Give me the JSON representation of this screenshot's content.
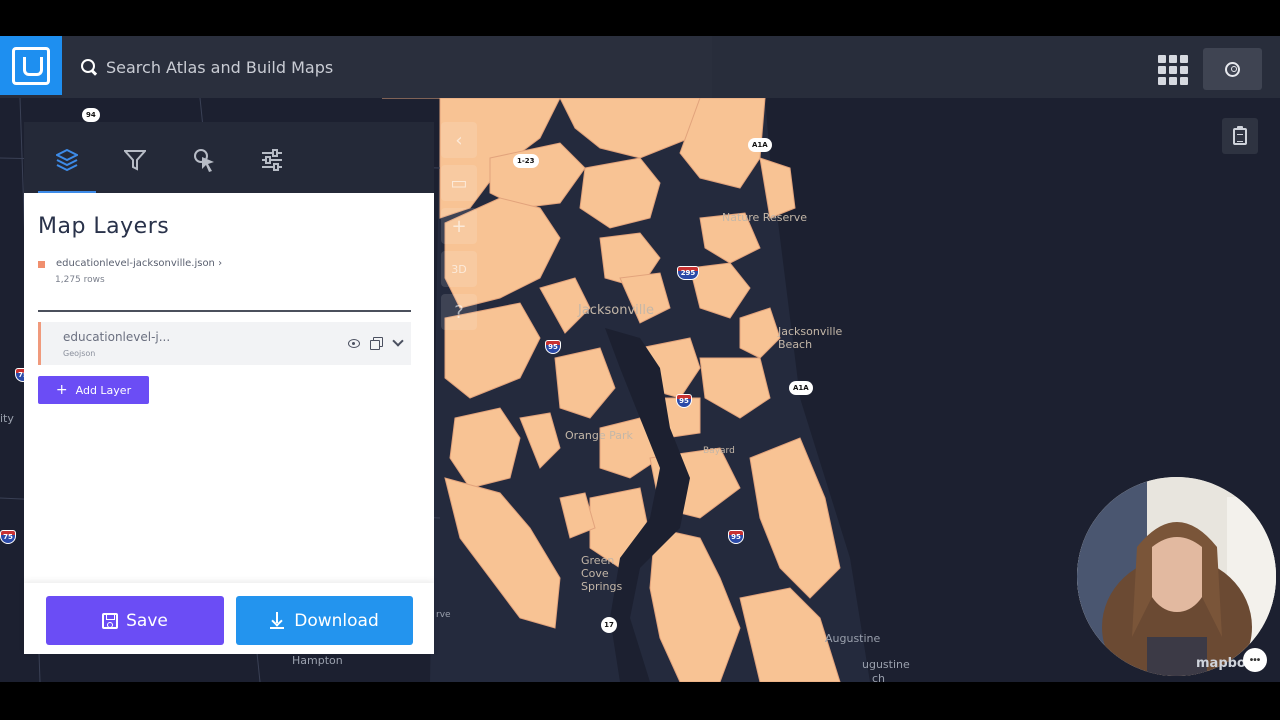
{
  "app": {
    "name": "Atlas"
  },
  "search": {
    "placeholder": "Search Atlas and Build Maps"
  },
  "panel": {
    "tabs": [
      {
        "icon": "layers-icon",
        "active": true
      },
      {
        "icon": "filter-icon",
        "active": false
      },
      {
        "icon": "cursor-icon",
        "active": false
      },
      {
        "icon": "sliders-icon",
        "active": false
      }
    ],
    "title": "Map Layers",
    "dataset": {
      "name": "educationlevel-jacksonville.json",
      "rows": "1,275 rows",
      "color": "#f08f6e"
    },
    "layer": {
      "name": "educationlevel-j...",
      "type": "Geojson",
      "color": "#f09a7c"
    },
    "add_layer_label": "Add Layer",
    "save_label": "Save",
    "download_label": "Download"
  },
  "map_controls": [
    {
      "icon": "collapse-left-icon",
      "glyph": "‹"
    },
    {
      "icon": "split-map-icon",
      "glyph": "▭"
    },
    {
      "icon": "zoom-in-icon",
      "glyph": "+"
    },
    {
      "icon": "3d-view-icon",
      "glyph": "3D"
    },
    {
      "icon": "help-icon",
      "glyph": "?"
    }
  ],
  "map": {
    "fill_color": "#f8c394",
    "base_color": "#1c2030",
    "labels": {
      "nature_reserve": "Nature Reserve",
      "jacksonville": "Jacksonville",
      "jacksonville_beach": "Jacksonville Beach",
      "orange_park": "Orange Park",
      "bayard": "Bayard",
      "green_cove_springs": "Green Cove Springs",
      "st_augustine": "Augustine",
      "hampton": "Hampton",
      "city": "ity",
      "rve": "rve",
      "ugustine": "ugustine",
      "ch": "ch"
    },
    "shields": {
      "r94": "94",
      "i295": "295",
      "i95a": "95",
      "i95b": "95",
      "i95c": "95",
      "i75a": "75",
      "i75b": "75",
      "a1a_a": "A1A",
      "a1a_b": "A1A",
      "r17": "17",
      "i23": "1-23"
    },
    "attribution": "mapbox"
  }
}
